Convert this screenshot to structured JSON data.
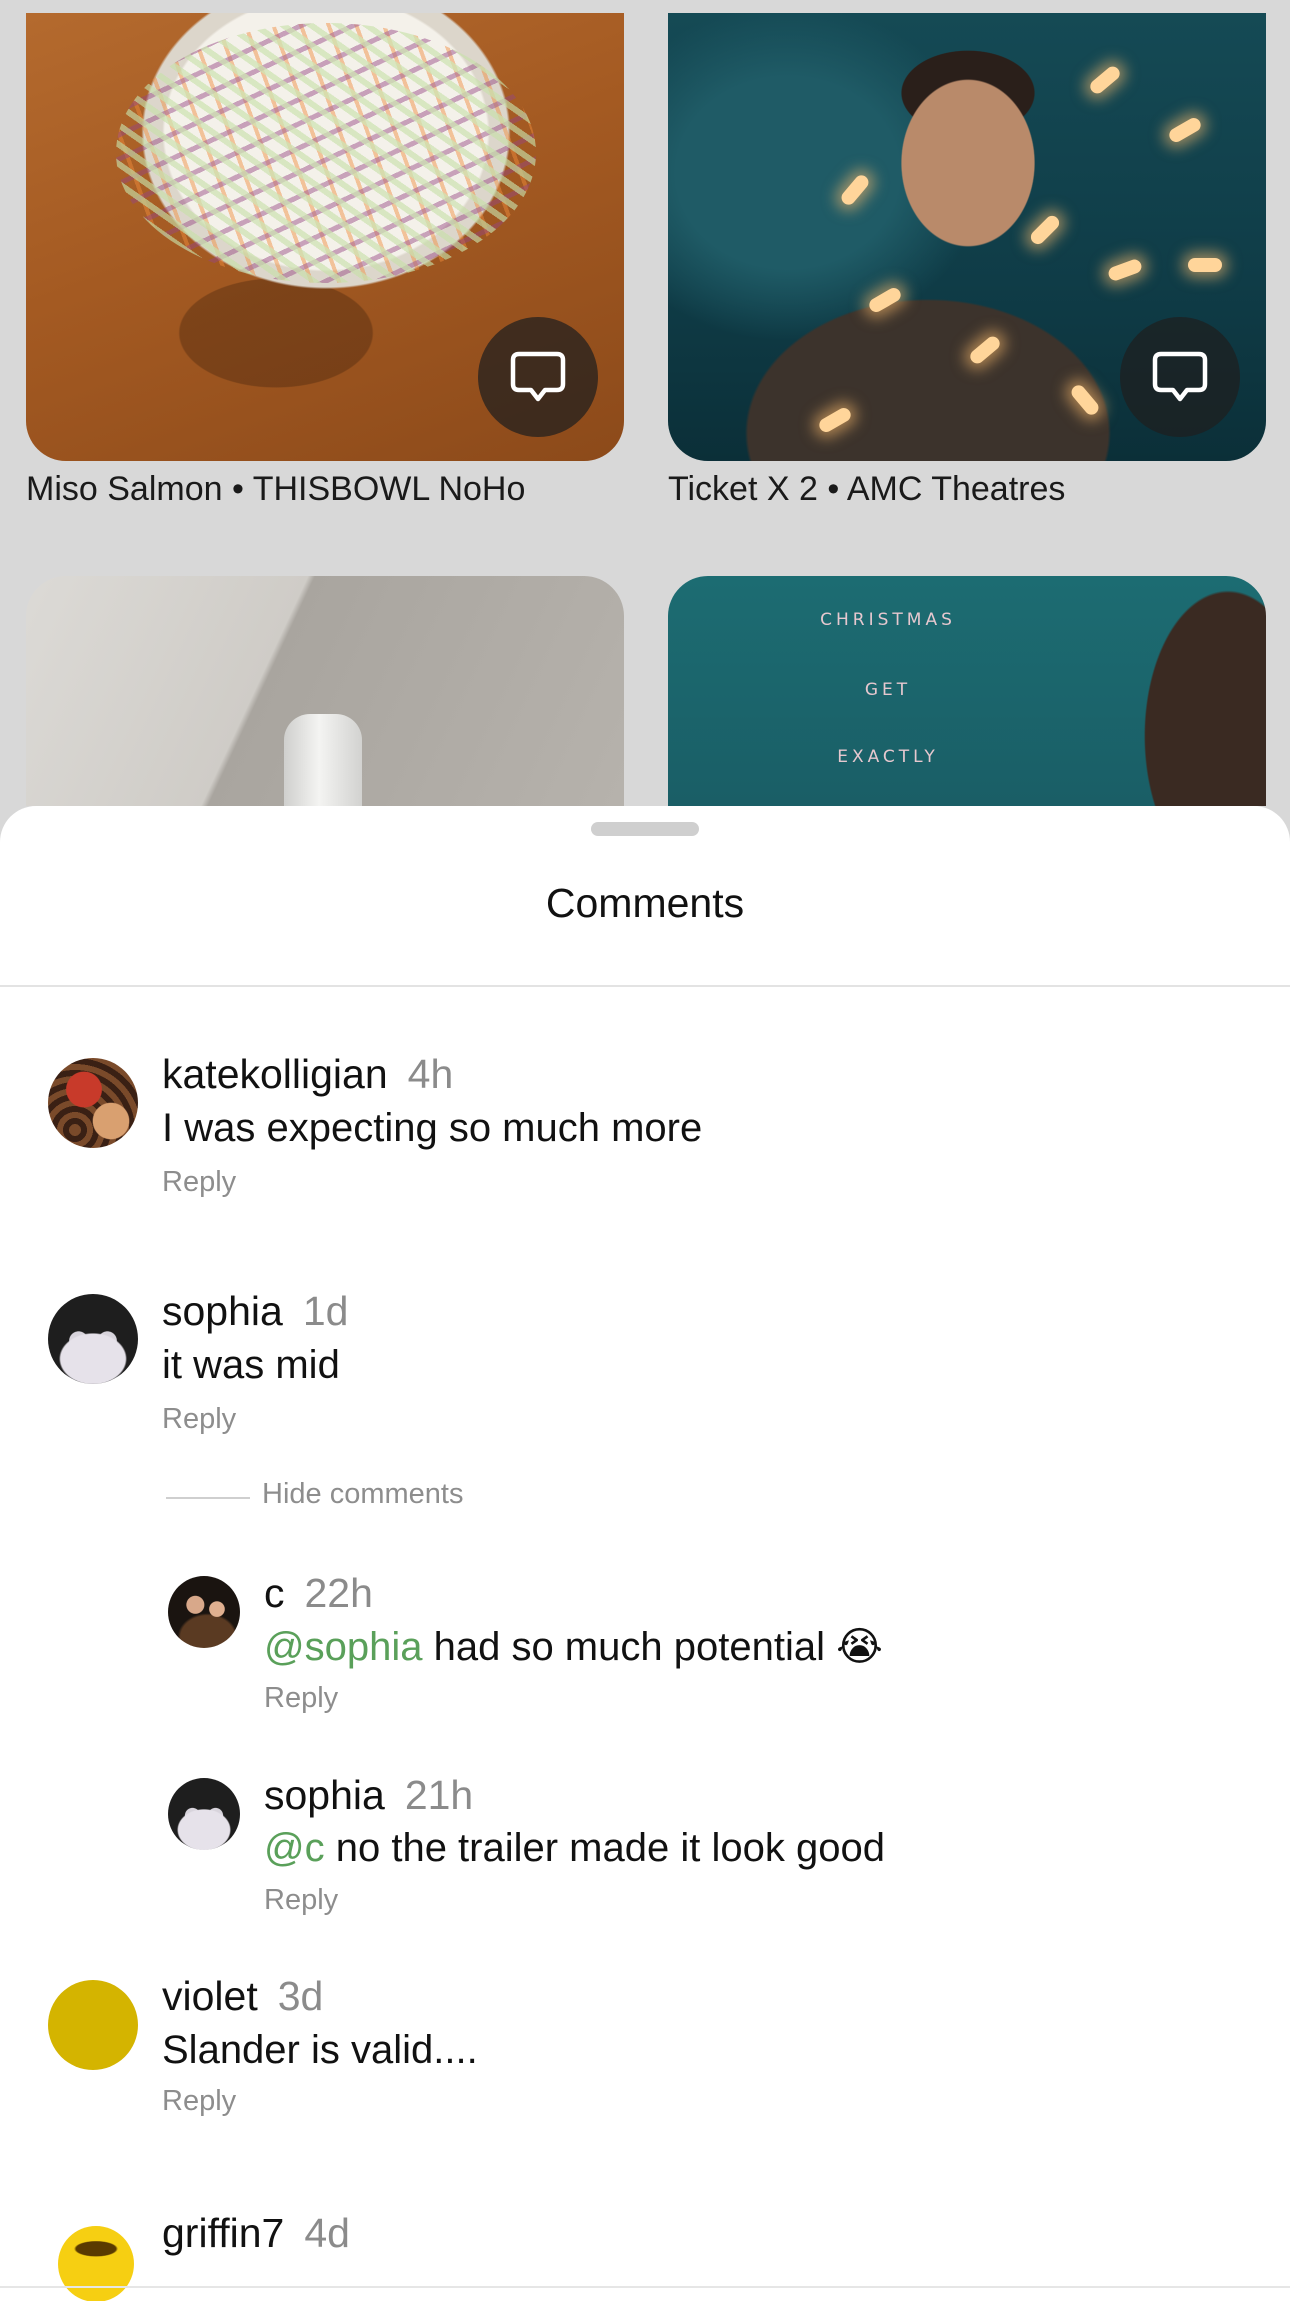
{
  "feed": {
    "cards": [
      {
        "caption": "Miso Salmon • THISBOWL NoHo",
        "comment_icon": "speech-bubble-icon"
      },
      {
        "caption": "Ticket X 2 • AMC Theatres",
        "comment_icon": "speech-bubble-icon"
      }
    ],
    "poster_lines": [
      "CHRISTMAS",
      "GET",
      "EXACTLY"
    ]
  },
  "sheet": {
    "title": "Comments",
    "hide_comments_label": "Hide comments",
    "comments": [
      {
        "user": "katekolligian",
        "time": "4h",
        "text": "I was expecting so much more",
        "reply": "Reply"
      },
      {
        "user": "sophia",
        "time": "1d",
        "text": "it was mid",
        "reply": "Reply"
      },
      {
        "user": "c",
        "time": "22h",
        "mention": "@sophia",
        "text": " had so much potential 😭",
        "reply": "Reply"
      },
      {
        "user": "sophia",
        "time": "21h",
        "mention": "@c",
        "text": " no the trailer made it look good",
        "reply": "Reply"
      },
      {
        "user": "violet",
        "time": "3d",
        "text": "Slander is valid....",
        "reply": "Reply"
      },
      {
        "user": "griffin7",
        "time": "4d"
      }
    ]
  },
  "colors": {
    "mention": "#5aa05a",
    "timestamp": "#8b8b8b",
    "violet_avatar": "#d4b400"
  }
}
